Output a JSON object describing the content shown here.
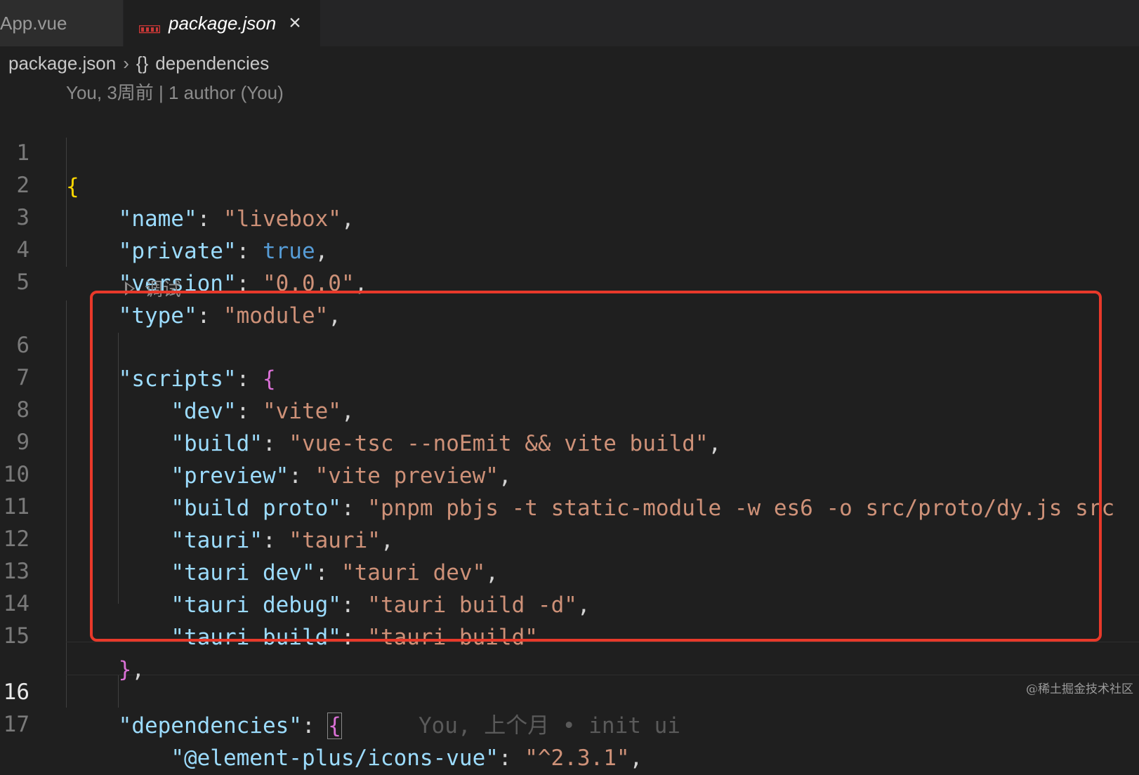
{
  "tabs": [
    {
      "label": "App.vue",
      "active": false
    },
    {
      "label": "package.json",
      "active": true,
      "icon": "npm-icon"
    }
  ],
  "breadcrumb": {
    "file": "package.json",
    "symbol": "dependencies",
    "symbol_icon": "braces-icon"
  },
  "codelens": {
    "author_line": "You, 3周前 | 1 author (You)",
    "debug_label": "调试"
  },
  "editor": {
    "line_numbers": [
      "1",
      "2",
      "3",
      "4",
      "5",
      "6",
      "7",
      "8",
      "9",
      "10",
      "11",
      "12",
      "13",
      "14",
      "15",
      "16",
      "17"
    ],
    "current_line": "16",
    "lines": {
      "l1": {
        "open": "{"
      },
      "l2": {
        "key": "\"name\"",
        "value": "\"livebox\""
      },
      "l3": {
        "key": "\"private\"",
        "value": "true"
      },
      "l4": {
        "key": "\"version\"",
        "value": "\"0.0.0\""
      },
      "l5": {
        "key": "\"type\"",
        "value": "\"module\""
      },
      "l6": {
        "key": "\"scripts\"",
        "open": "{"
      },
      "l7": {
        "key": "\"dev\"",
        "value": "\"vite\""
      },
      "l8": {
        "key": "\"build\"",
        "value": "\"vue-tsc --noEmit && vite build\""
      },
      "l9": {
        "key": "\"preview\"",
        "value": "\"vite preview\""
      },
      "l10": {
        "key": "\"build proto\"",
        "value": "\"pnpm pbjs -t static-module -w es6 -o src/proto/dy.js src"
      },
      "l11": {
        "key": "\"tauri\"",
        "value": "\"tauri\""
      },
      "l12": {
        "key": "\"tauri dev\"",
        "value": "\"tauri dev\""
      },
      "l13": {
        "key": "\"tauri debug\"",
        "value": "\"tauri build -d\""
      },
      "l14": {
        "key": "\"tauri build\"",
        "value": "\"tauri build\""
      },
      "l15": {
        "close": "}"
      },
      "l16": {
        "key": "\"dependencies\"",
        "open": "{",
        "blame": "You, 上个月 • init ui"
      },
      "l17": {
        "key": "\"@element-plus/icons-vue\"",
        "value": "\"^2.3.1\""
      }
    }
  },
  "watermark": "@稀土掘金技术社区",
  "colors": {
    "background": "#1f1f1f",
    "key": "#9cdcfe",
    "string": "#ce9178",
    "boolean": "#569cd6",
    "brace_level1": "#ffd700",
    "brace_level2": "#da70d6",
    "highlight_box": "#e8392a"
  }
}
